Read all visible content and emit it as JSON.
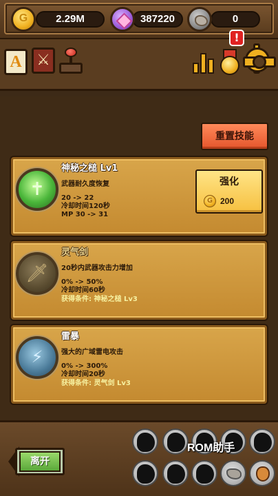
{
  "resources": {
    "gold": "2.29M",
    "gems": "387220",
    "ore": "0"
  },
  "toolbar": {
    "book_letter": "A",
    "alert_mark": "!"
  },
  "reset_button": "重置技能",
  "skills": [
    {
      "name": "神秘之槌 Lv1",
      "desc": "武器耐久度恢复",
      "line1": "20 -> 22",
      "line2": "冷却时间120秒",
      "line3": "MP 30 -> 31",
      "requirement": "",
      "icon": "cross-glow-icon",
      "upgrade_label": "强化",
      "upgrade_cost": "200"
    },
    {
      "name": "灵气剑",
      "desc": "20秒内武器攻击力增加",
      "line1": "0% -> 50%",
      "line2": "冷却时间60秒",
      "requirement": "获得条件: 神秘之槌 Lv3",
      "icon": "sword-icon"
    },
    {
      "name": "雷暴",
      "desc": "强大的广域雷电攻击",
      "line1": "0% -> 300%",
      "line2": "冷却时间20秒",
      "requirement": "获得条件: 灵气剑 Lv3",
      "icon": "lightning-icon"
    }
  ],
  "bottom": {
    "leave_label": "离开",
    "watermark": "ROM助手"
  },
  "colors": {
    "background": "#3d2a17",
    "card": "#d8a54a",
    "reset_button": "#ff8a5a",
    "upgrade_button": "#f6c040",
    "requirement_text": "#f6f0a0"
  }
}
